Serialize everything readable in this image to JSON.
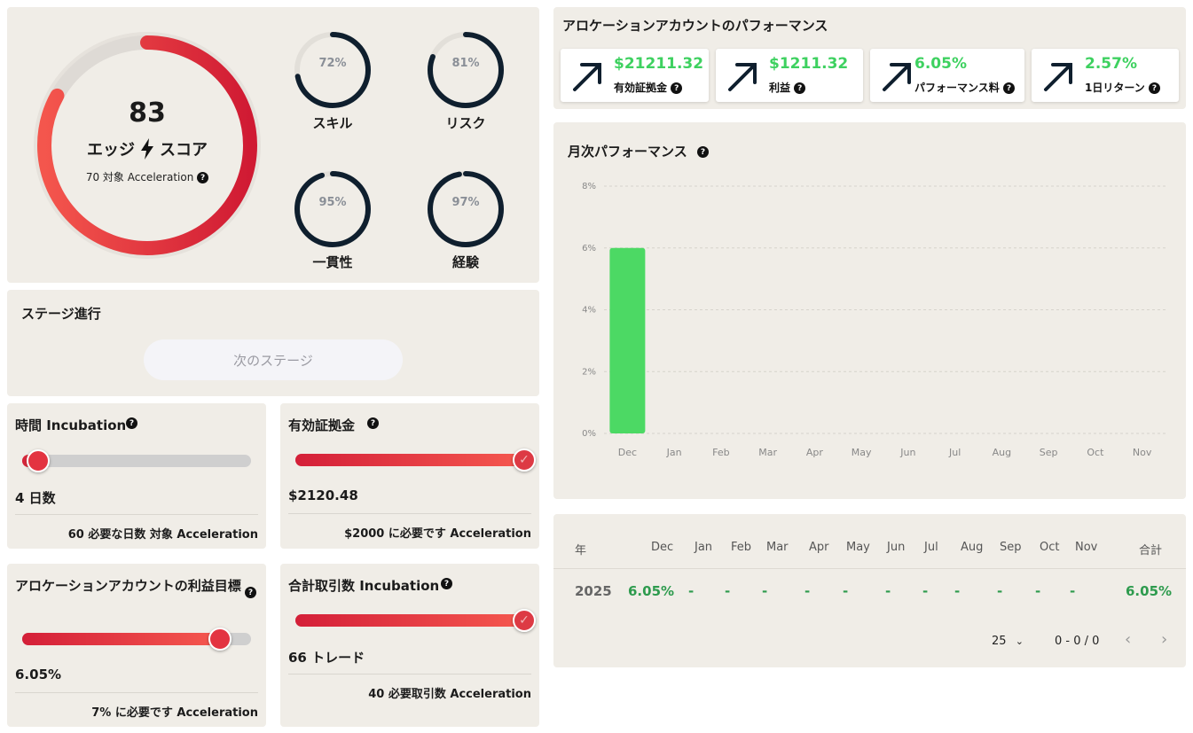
{
  "score": {
    "value": "83",
    "label_left": "エッジ",
    "label_right": "スコア",
    "sub": "70 対象 Acceleration",
    "fraction": 0.83,
    "colors": {
      "arc_start": "#f4564d",
      "arc_end": "#d01a33",
      "track": "#dedad5"
    }
  },
  "mini_gauges": [
    {
      "pct_text": "72%",
      "fraction": 0.72,
      "label": "スキル"
    },
    {
      "pct_text": "81%",
      "fraction": 0.81,
      "label": "リスク"
    },
    {
      "pct_text": "95%",
      "fraction": 0.95,
      "label": "一貫性"
    },
    {
      "pct_text": "97%",
      "fraction": 0.97,
      "label": "経験"
    }
  ],
  "stage": {
    "title": "ステージ進行",
    "next_button": "次のステージ"
  },
  "progress": {
    "time": {
      "title": "時間 Incubation",
      "value": "4 日数",
      "footer": "60 必要な日数 対象 Acceleration",
      "fraction": 0.07
    },
    "margin": {
      "title": "有効証拠金",
      "value": "$2120.48",
      "footer": "$2000 に必要です Acceleration",
      "fraction": 1.0
    },
    "profit": {
      "title": "アロケーションアカウントの利益目標",
      "value": "6.05%",
      "footer": "7% に必要です Acceleration",
      "fraction": 0.864
    },
    "trades": {
      "title": "合計取引数 Incubation",
      "value": "66 トレード",
      "footer": "40 必要取引数 Acceleration",
      "fraction": 1.0
    }
  },
  "performance": {
    "title": "アロケーションアカウントのパフォーマンス",
    "stats": [
      {
        "value": "$21211.32",
        "label": "有効証拠金"
      },
      {
        "value": "$1211.32",
        "label": "利益"
      },
      {
        "value": "6.05%",
        "label": "パフォーマンス料"
      },
      {
        "value": "2.57%",
        "label": "1日リターン"
      }
    ],
    "accent": "#3ed160"
  },
  "monthly": {
    "title": "月次パフォーマンス"
  },
  "chart_data": {
    "type": "bar",
    "categories": [
      "Dec",
      "Jan",
      "Feb",
      "Mar",
      "Apr",
      "May",
      "Jun",
      "Jul",
      "Aug",
      "Sep",
      "Oct",
      "Nov"
    ],
    "values": [
      6,
      0,
      0,
      0,
      0,
      0,
      0,
      0,
      0,
      0,
      0,
      0
    ],
    "yticks": [
      "0%",
      "2%",
      "4%",
      "6%",
      "8%"
    ],
    "ylim": [
      0,
      8
    ],
    "grid": true,
    "bar_color": "#4cd964"
  },
  "table": {
    "headers": [
      "年",
      "Dec",
      "Jan",
      "Feb",
      "Mar",
      "Apr",
      "May",
      "Jun",
      "Jul",
      "Aug",
      "Sep",
      "Oct",
      "Nov",
      "合計"
    ],
    "rows": [
      [
        "2025",
        "6.05%",
        "-",
        "-",
        "-",
        "-",
        "-",
        "-",
        "-",
        "-",
        "-",
        "-",
        "-",
        "6.05%"
      ]
    ],
    "page_size": "25",
    "range": "0 - 0 / 0"
  },
  "help_glyph": "?"
}
